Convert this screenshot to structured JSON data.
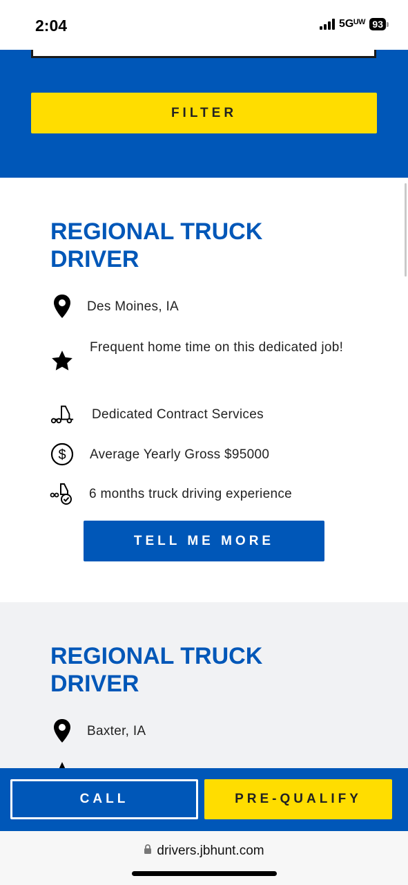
{
  "status_bar": {
    "time": "2:04",
    "network": "5Gᵁᵂ",
    "battery": "93"
  },
  "filter": {
    "label": "FILTER"
  },
  "jobs": [
    {
      "title": "REGIONAL TRUCK DRIVER",
      "location": "Des Moines, IA",
      "home_time": "Frequent home time on this dedicated job!",
      "division": "Dedicated Contract Services",
      "pay": "Average Yearly Gross $95000",
      "experience": "6 months truck driving experience",
      "cta": "TELL ME MORE"
    },
    {
      "title": "REGIONAL TRUCK DRIVER",
      "location": "Baxter, IA"
    }
  ],
  "bottom_bar": {
    "call_label": "CALL",
    "prequalify_label": "PRE-QUALIFY"
  },
  "browser": {
    "url": "drivers.jbhunt.com"
  },
  "colors": {
    "brand_blue": "#0057b8",
    "brand_yellow": "#ffdd00"
  },
  "icons": [
    "location-pin-icon",
    "star-icon",
    "truck-icon",
    "dollar-icon",
    "truck-check-icon",
    "lock-icon"
  ]
}
